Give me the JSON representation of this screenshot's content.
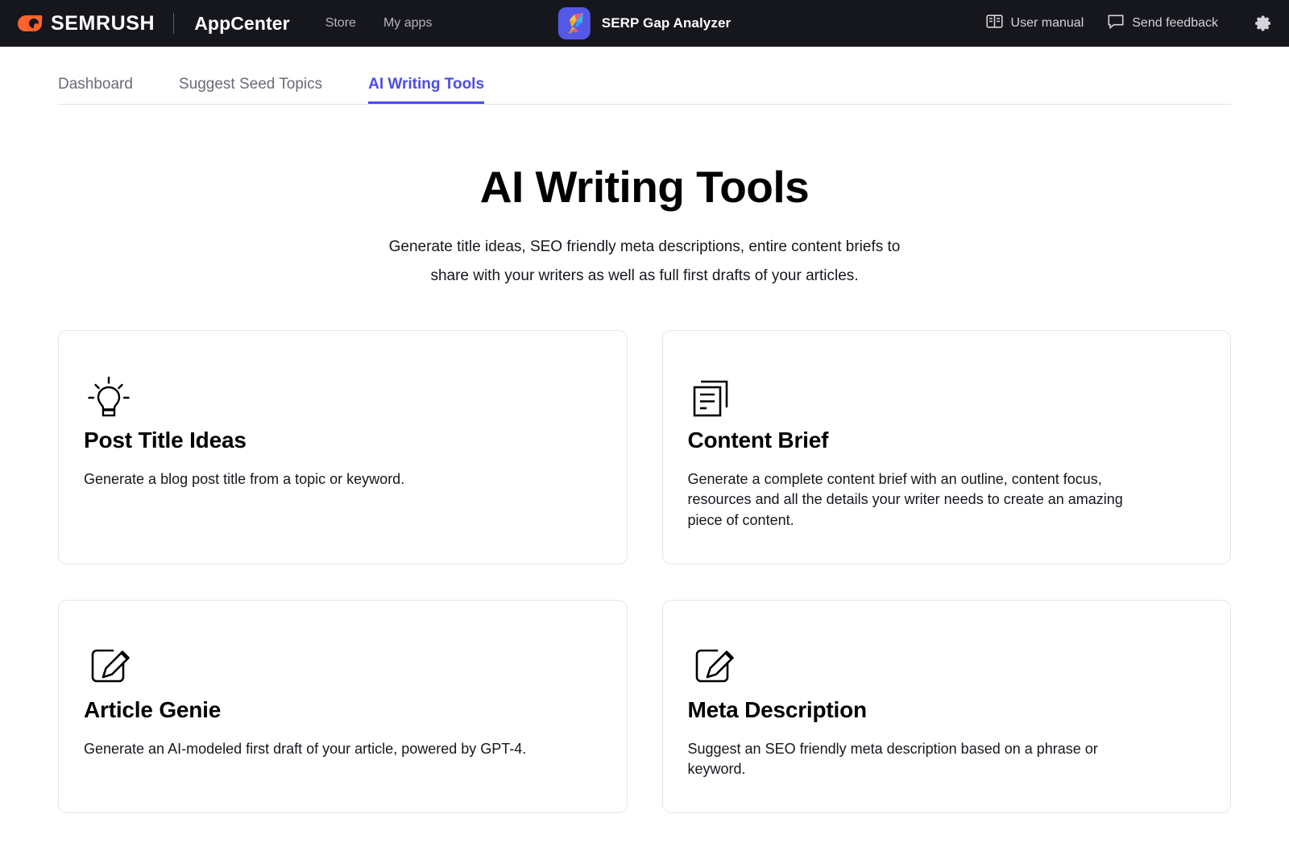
{
  "topbar": {
    "brand_name": "SEMRUSH",
    "brand_sub": "AppCenter",
    "nav": [
      {
        "label": "Store",
        "icon": ""
      },
      {
        "label": "My apps",
        "icon": ""
      }
    ],
    "app_title": "SERP Gap Analyzer",
    "app_icon": "hummingbird-app-icon",
    "user_manual_label": "User manual",
    "user_manual_icon": "book-icon",
    "send_feedback_label": "Send feedback",
    "send_feedback_icon": "speech-bubble-icon",
    "settings_icon": "gear-icon",
    "accent_color": "#ff642d",
    "background_color": "#16161d"
  },
  "tabs": [
    {
      "label": "Dashboard",
      "active": false
    },
    {
      "label": "Suggest Seed Topics",
      "active": false
    },
    {
      "label": "AI Writing Tools",
      "active": true
    }
  ],
  "tab_accent_color": "#4b4ce8",
  "hero": {
    "title": "AI Writing Tools",
    "subtitle_line1": "Generate title ideas, SEO friendly meta descriptions, entire content briefs to",
    "subtitle_line2": "share with your writers as well as full first drafts of your articles."
  },
  "cards": [
    {
      "icon": "lightbulb-icon",
      "title": "Post Title Ideas",
      "description": "Generate a blog post title from a topic or keyword."
    },
    {
      "icon": "stacked-documents-icon",
      "title": "Content Brief",
      "description": "Generate a complete content brief with an outline, content focus, resources and all the details your writer needs to create an amazing piece of content."
    },
    {
      "icon": "edit-pencil-icon",
      "title": "Article Genie",
      "description": "Generate an AI-modeled first draft of your article, powered by GPT-4."
    },
    {
      "icon": "edit-pencil-icon",
      "title": "Meta Description",
      "description": "Suggest an SEO friendly meta description based on a phrase or keyword."
    }
  ]
}
